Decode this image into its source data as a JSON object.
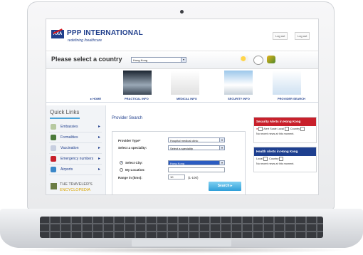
{
  "site": {
    "brand": "PPP INTERNATIONAL",
    "tagline": "redefining /healthcare",
    "logo_text": "AXA",
    "top_buttons": [
      "Log out",
      "Log out"
    ]
  },
  "country_bar": {
    "label": "Please select a country",
    "selected_country": "Hong Kong"
  },
  "nav": {
    "items": [
      "HOME",
      "PRACTICAL INFO",
      "MEDICAL INFO",
      "SECURITY INFO",
      "PROVIDER SEARCH"
    ]
  },
  "quick_links": {
    "title": "Quick Links",
    "items": [
      "Embassies",
      "Formalities",
      "Vaccination",
      "Emergency numbers",
      "Airports"
    ],
    "encyclopedia_line1": "THE TRAVELER'S",
    "encyclopedia_line2": "ENCYCLOPEDIA"
  },
  "provider_search": {
    "title": "Provider Search",
    "provider_type_label": "Provider Type*",
    "provider_type_value": "Hospital medical clinic",
    "speciality_label": "Select a speciality:",
    "speciality_value": "Select a speciality",
    "select_city_label": "Select City:",
    "city_value": "Hong Kong",
    "my_location_label": "My Location:",
    "range_label": "Range in (kms):",
    "range_value": "10",
    "range_hint": "(1-100)",
    "search_button": "Search"
  },
  "security_alerts": {
    "title": "Security Alerts in Hong Kong",
    "alert_scale_label": "Alert Scale",
    "local_label": "Local",
    "country_label": "Country",
    "no_news": "No recent news at this moment."
  },
  "health_alerts": {
    "title": "Health Alerts in Hong Kong",
    "local_label": "Local",
    "country_label": "Country",
    "no_news": "No recent news at this moment."
  },
  "colors": {
    "brand_blue": "#1f3e8c",
    "alert_red": "#c8202b",
    "health_blue": "#1e3f8f",
    "search_button": "#2f9fd8"
  }
}
